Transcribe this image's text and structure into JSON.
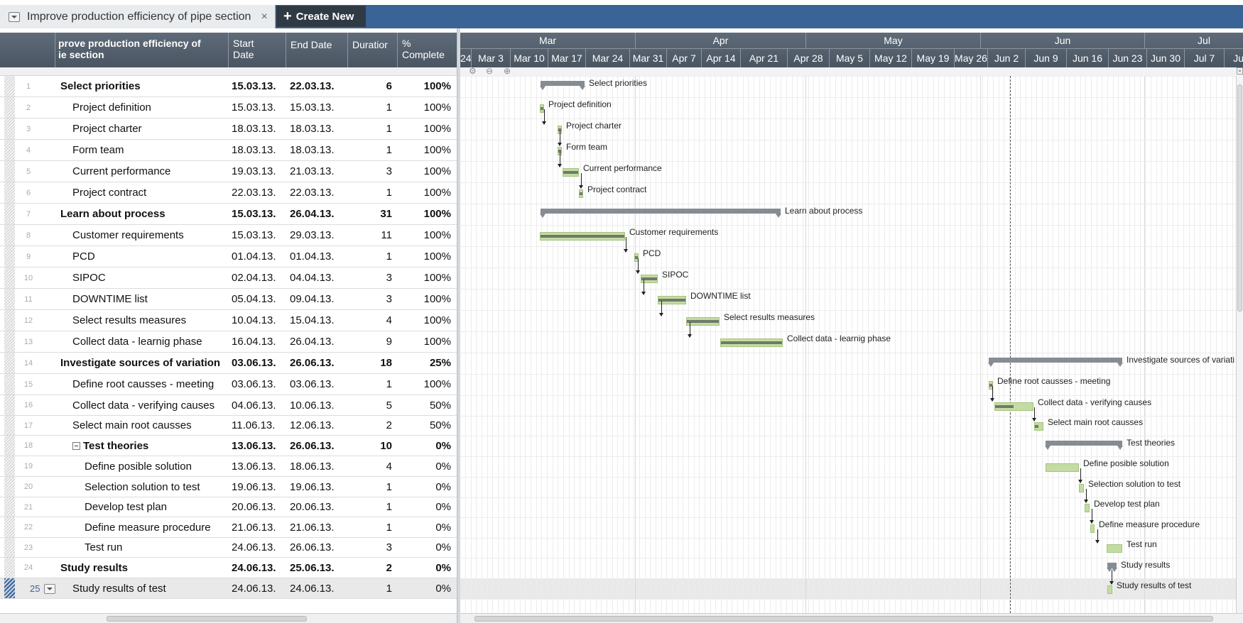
{
  "tab": {
    "title": "Improve production efficiency of pipe section",
    "close": "×"
  },
  "create_new": {
    "label": "Create New",
    "icon": "plus-icon"
  },
  "grid": {
    "columns": {
      "name": "prove production efficiency of\nie section",
      "start": "Start\nDate",
      "end": "End Date",
      "duration": "Duratior",
      "complete": "%\nComplete"
    },
    "rows": [
      {
        "num": "1",
        "name": "Select priorities",
        "start": "15.03.13.",
        "end": "22.03.13.",
        "dur": "6",
        "pct": "100%",
        "summary": true,
        "indent": 0
      },
      {
        "num": "2",
        "name": "Project definition",
        "start": "15.03.13.",
        "end": "15.03.13.",
        "dur": "1",
        "pct": "100%",
        "indent": 1
      },
      {
        "num": "3",
        "name": "Project charter",
        "start": "18.03.13.",
        "end": "18.03.13.",
        "dur": "1",
        "pct": "100%",
        "indent": 1
      },
      {
        "num": "4",
        "name": "Form team",
        "start": "18.03.13.",
        "end": "18.03.13.",
        "dur": "1",
        "pct": "100%",
        "indent": 1
      },
      {
        "num": "5",
        "name": "Current performance",
        "start": "19.03.13.",
        "end": "21.03.13.",
        "dur": "3",
        "pct": "100%",
        "indent": 1
      },
      {
        "num": "6",
        "name": "Project contract",
        "start": "22.03.13.",
        "end": "22.03.13.",
        "dur": "1",
        "pct": "100%",
        "indent": 1
      },
      {
        "num": "7",
        "name": "Learn about process",
        "start": "15.03.13.",
        "end": "26.04.13.",
        "dur": "31",
        "pct": "100%",
        "summary": true,
        "indent": 0
      },
      {
        "num": "8",
        "name": "Customer requirements",
        "start": "15.03.13.",
        "end": "29.03.13.",
        "dur": "11",
        "pct": "100%",
        "indent": 1
      },
      {
        "num": "9",
        "name": "PCD",
        "start": "01.04.13.",
        "end": "01.04.13.",
        "dur": "1",
        "pct": "100%",
        "indent": 1
      },
      {
        "num": "10",
        "name": "SIPOC",
        "start": "02.04.13.",
        "end": "04.04.13.",
        "dur": "3",
        "pct": "100%",
        "indent": 1
      },
      {
        "num": "11",
        "name": "DOWNTIME list",
        "start": "05.04.13.",
        "end": "09.04.13.",
        "dur": "3",
        "pct": "100%",
        "indent": 1
      },
      {
        "num": "12",
        "name": "Select results measures",
        "start": "10.04.13.",
        "end": "15.04.13.",
        "dur": "4",
        "pct": "100%",
        "indent": 1
      },
      {
        "num": "13",
        "name": "Collect data - learnig phase",
        "start": "16.04.13.",
        "end": "26.04.13.",
        "dur": "9",
        "pct": "100%",
        "indent": 1
      },
      {
        "num": "14",
        "name": "Investigate sources of variation",
        "start": "03.06.13.",
        "end": "26.06.13.",
        "dur": "18",
        "pct": "25%",
        "summary": true,
        "indent": 0
      },
      {
        "num": "15",
        "name": "Define root causses - meeting",
        "start": "03.06.13.",
        "end": "03.06.13.",
        "dur": "1",
        "pct": "100%",
        "indent": 1
      },
      {
        "num": "16",
        "name": "Collect data - verifying causes",
        "start": "04.06.13.",
        "end": "10.06.13.",
        "dur": "5",
        "pct": "50%",
        "indent": 1
      },
      {
        "num": "17",
        "name": "Select main root causses",
        "start": "11.06.13.",
        "end": "12.06.13.",
        "dur": "2",
        "pct": "50%",
        "indent": 1
      },
      {
        "num": "18",
        "name": "Test theories",
        "start": "13.06.13.",
        "end": "26.06.13.",
        "dur": "10",
        "pct": "0%",
        "summary": true,
        "collapsible": true,
        "indent": 1
      },
      {
        "num": "19",
        "name": "Define posible solution",
        "start": "13.06.13.",
        "end": "18.06.13.",
        "dur": "4",
        "pct": "0%",
        "indent": 2
      },
      {
        "num": "20",
        "name": "Selection solution to test",
        "start": "19.06.13.",
        "end": "19.06.13.",
        "dur": "1",
        "pct": "0%",
        "indent": 2
      },
      {
        "num": "21",
        "name": "Develop test plan",
        "start": "20.06.13.",
        "end": "20.06.13.",
        "dur": "1",
        "pct": "0%",
        "indent": 2
      },
      {
        "num": "22",
        "name": "Define measure procedure",
        "start": "21.06.13.",
        "end": "21.06.13.",
        "dur": "1",
        "pct": "0%",
        "indent": 2
      },
      {
        "num": "23",
        "name": "Test run",
        "start": "24.06.13.",
        "end": "26.06.13.",
        "dur": "3",
        "pct": "0%",
        "indent": 2
      },
      {
        "num": "24",
        "name": "Study results",
        "start": "24.06.13.",
        "end": "25.06.13.",
        "dur": "2",
        "pct": "0%",
        "summary": true,
        "indent": 0
      },
      {
        "num": "25",
        "name": "Study results of test",
        "start": "24.06.13.",
        "end": "24.06.13.",
        "dur": "1",
        "pct": "0%",
        "indent": 1,
        "selected": true
      }
    ]
  },
  "gantt": {
    "months": [
      "Mar",
      "Apr",
      "May",
      "Jun",
      "Jul"
    ],
    "weeks": [
      "24",
      "Mar 3",
      "Mar 10",
      "Mar 17",
      "Mar 24",
      "Mar 31",
      "Apr 7",
      "Apr 14",
      "Apr 21",
      "Apr 28",
      "May 5",
      "May 12",
      "May 19",
      "May 26",
      "Jun 2",
      "Jun 9",
      "Jun 16",
      "Jun 23",
      "Jun 30",
      "Jul 7",
      "Jul 1"
    ],
    "labels": [
      "Select priorities",
      "Project definition",
      "Project charter",
      "Form team",
      "Current performance",
      "Project contract",
      "Learn about process",
      "Customer requirements",
      "PCD",
      "SIPOC",
      "DOWNTIME list",
      "Select results measures",
      "Collect data - learnig phase",
      "Investigate sources of variati",
      "Define root causses - meeting",
      "Collect data - verifying causes",
      "Select main root causses",
      "Test theories",
      "Define posible solution",
      "Selection solution to test",
      "Develop test plan",
      "Define measure procedure",
      "Test run",
      "Study results",
      "Study results of test"
    ]
  },
  "colors": {
    "header": "#4f5b68",
    "tabbar": "#3a6496",
    "bar": "#c4dca3",
    "summary": "#858c93"
  }
}
